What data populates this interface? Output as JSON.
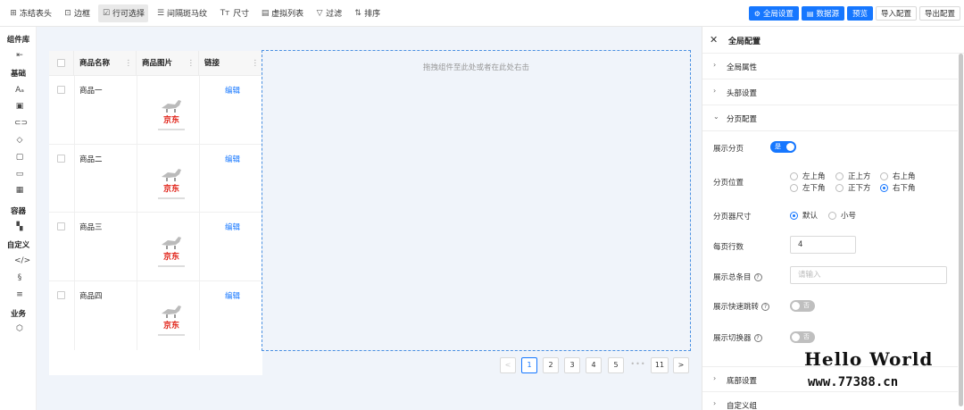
{
  "toolbar": {
    "items": [
      {
        "icon": "grid-icon",
        "glyph": "⊞",
        "label": "冻结表头"
      },
      {
        "icon": "border-icon",
        "glyph": "⊡",
        "label": "边框"
      },
      {
        "icon": "checkbox-icon",
        "glyph": "☑",
        "label": "行可选择"
      },
      {
        "icon": "stripe-icon",
        "glyph": "☰",
        "label": "间隔斑马纹"
      },
      {
        "icon": "text-size-icon",
        "glyph": "Tт",
        "label": "尺寸"
      },
      {
        "icon": "list-icon",
        "glyph": "▤",
        "label": "虚拟列表"
      },
      {
        "icon": "filter-icon",
        "glyph": "▽",
        "label": "过滤"
      },
      {
        "icon": "sort-icon",
        "glyph": "⇅",
        "label": "排序"
      }
    ],
    "buttons": {
      "global_settings": "全局设置",
      "datasource": "数据源",
      "preview": "预览",
      "import": "导入配置",
      "export": "导出配置"
    }
  },
  "sidebar": {
    "library_title": "组件库",
    "sections": {
      "basic": "基础",
      "container": "容器",
      "custom": "自定义",
      "business": "业务"
    }
  },
  "table": {
    "headers": [
      "商品名称",
      "商品图片",
      "链接"
    ],
    "rows": [
      {
        "name": "商品一",
        "image_text": "京东",
        "link": "编辑"
      },
      {
        "name": "商品二",
        "image_text": "京东",
        "link": "编辑"
      },
      {
        "name": "商品三",
        "image_text": "京东",
        "link": "编辑"
      },
      {
        "name": "商品四",
        "image_text": "京东",
        "link": "编辑"
      }
    ]
  },
  "dropzone": {
    "text": "拖拽组件至此处或者在此处右击"
  },
  "pagination": {
    "prev": "<",
    "pages": [
      "1",
      "2",
      "3",
      "4",
      "5"
    ],
    "ellipsis": "•••",
    "last": "11",
    "next": ">",
    "current": "1"
  },
  "panel": {
    "title": "全局配置",
    "sections": {
      "global_props": "全局属性",
      "header": "头部设置",
      "pagination": "分页配置",
      "footer": "底部设置",
      "custom_group": "自定义组"
    },
    "fields": {
      "show_pagination": {
        "label": "展示分页",
        "value": "是"
      },
      "position": {
        "label": "分页位置",
        "options": [
          "左上角",
          "正上方",
          "右上角",
          "左下角",
          "正下方",
          "右下角"
        ],
        "selected": "右下角"
      },
      "size": {
        "label": "分页器尺寸",
        "options": [
          "默认",
          "小号"
        ],
        "selected": "默认"
      },
      "page_size": {
        "label": "每页行数",
        "value": "4"
      },
      "show_total": {
        "label": "展示总条目",
        "placeholder": "请输入"
      },
      "quick_jumper": {
        "label": "展示快速跳转",
        "value": "否"
      },
      "size_changer": {
        "label": "展示切换器",
        "value": "否"
      }
    }
  },
  "watermark": {
    "line1": "Hello World",
    "line2": "www.77388.cn"
  },
  "colors": {
    "accent": "#1677ff",
    "canvas_bg": "#f0f4fa",
    "jd_red": "#e1251b"
  }
}
